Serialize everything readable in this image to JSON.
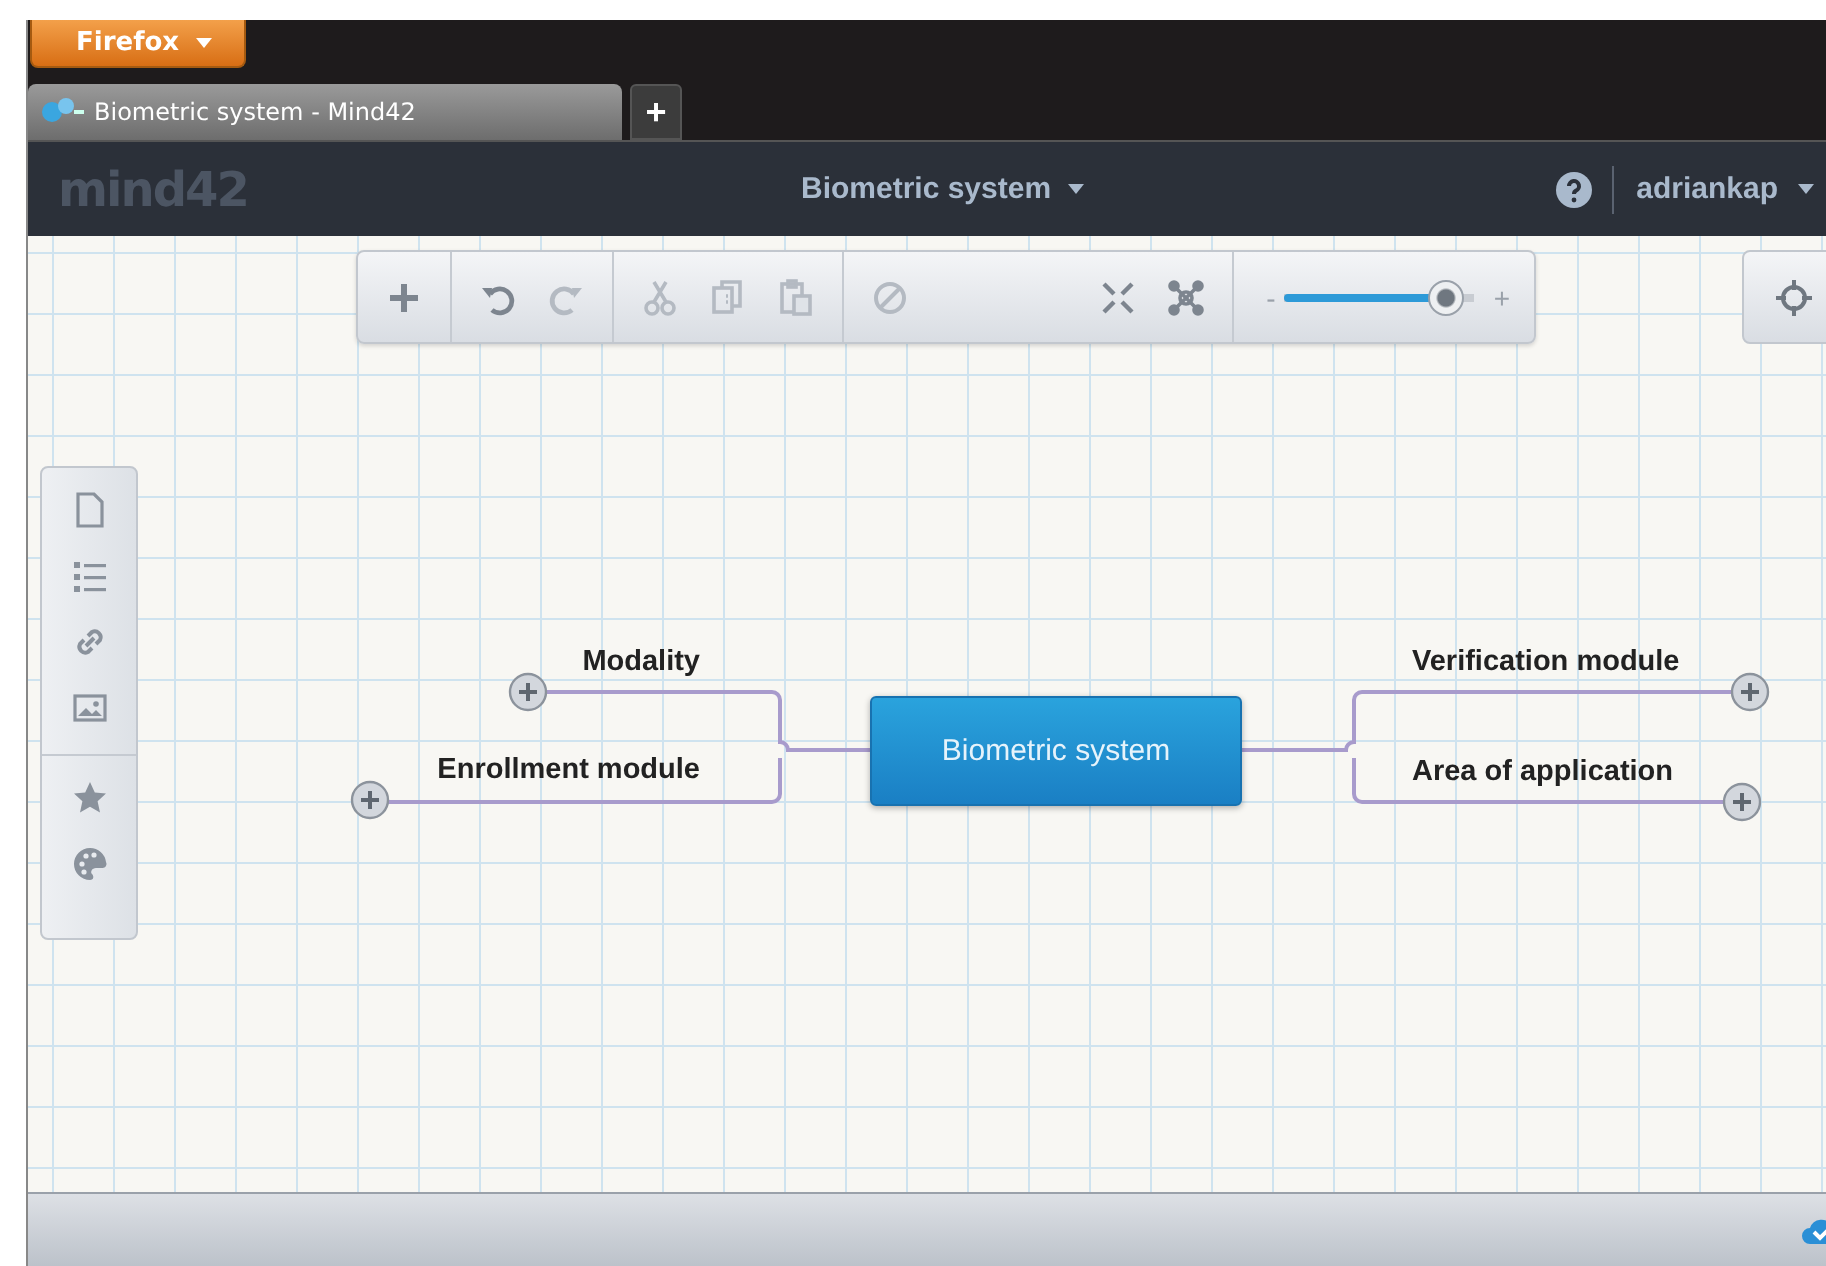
{
  "browser": {
    "menu_button": "Firefox",
    "tabs": [
      {
        "title": "Biometric system - Mind42",
        "selected": true
      }
    ],
    "new_tab": "+"
  },
  "app_header": {
    "logo": "mind42",
    "map_title": "Biometric system",
    "user": "adriankap"
  },
  "toolbar": {
    "groups": [
      [
        {
          "kind": "add",
          "disabled": false
        }
      ],
      [
        {
          "kind": "undo",
          "disabled": false
        },
        {
          "kind": "redo",
          "disabled": true
        }
      ],
      [
        {
          "kind": "cut",
          "disabled": true
        },
        {
          "kind": "copy",
          "disabled": true
        },
        {
          "kind": "paste",
          "disabled": true
        }
      ],
      [
        {
          "kind": "clear",
          "disabled": true
        },
        {
          "kind": "collapse",
          "disabled": false
        },
        {
          "kind": "layout",
          "disabled": false
        }
      ]
    ],
    "zoom": {
      "minus": "-",
      "plus": "+",
      "level": 0.85
    }
  },
  "side_panel": {
    "groups": [
      [
        {
          "kind": "note"
        },
        {
          "kind": "list"
        },
        {
          "kind": "link"
        },
        {
          "kind": "image"
        }
      ],
      [
        {
          "kind": "star"
        },
        {
          "kind": "palette"
        }
      ]
    ]
  },
  "mind_map": {
    "root": "Biometric system",
    "nodes": [
      {
        "text": "Modality",
        "kind": "left"
      },
      {
        "text": "Verification module",
        "kind": "right"
      },
      {
        "text": "Enrollment module",
        "kind": "left"
      },
      {
        "text": "Area of application",
        "kind": "right"
      }
    ]
  }
}
